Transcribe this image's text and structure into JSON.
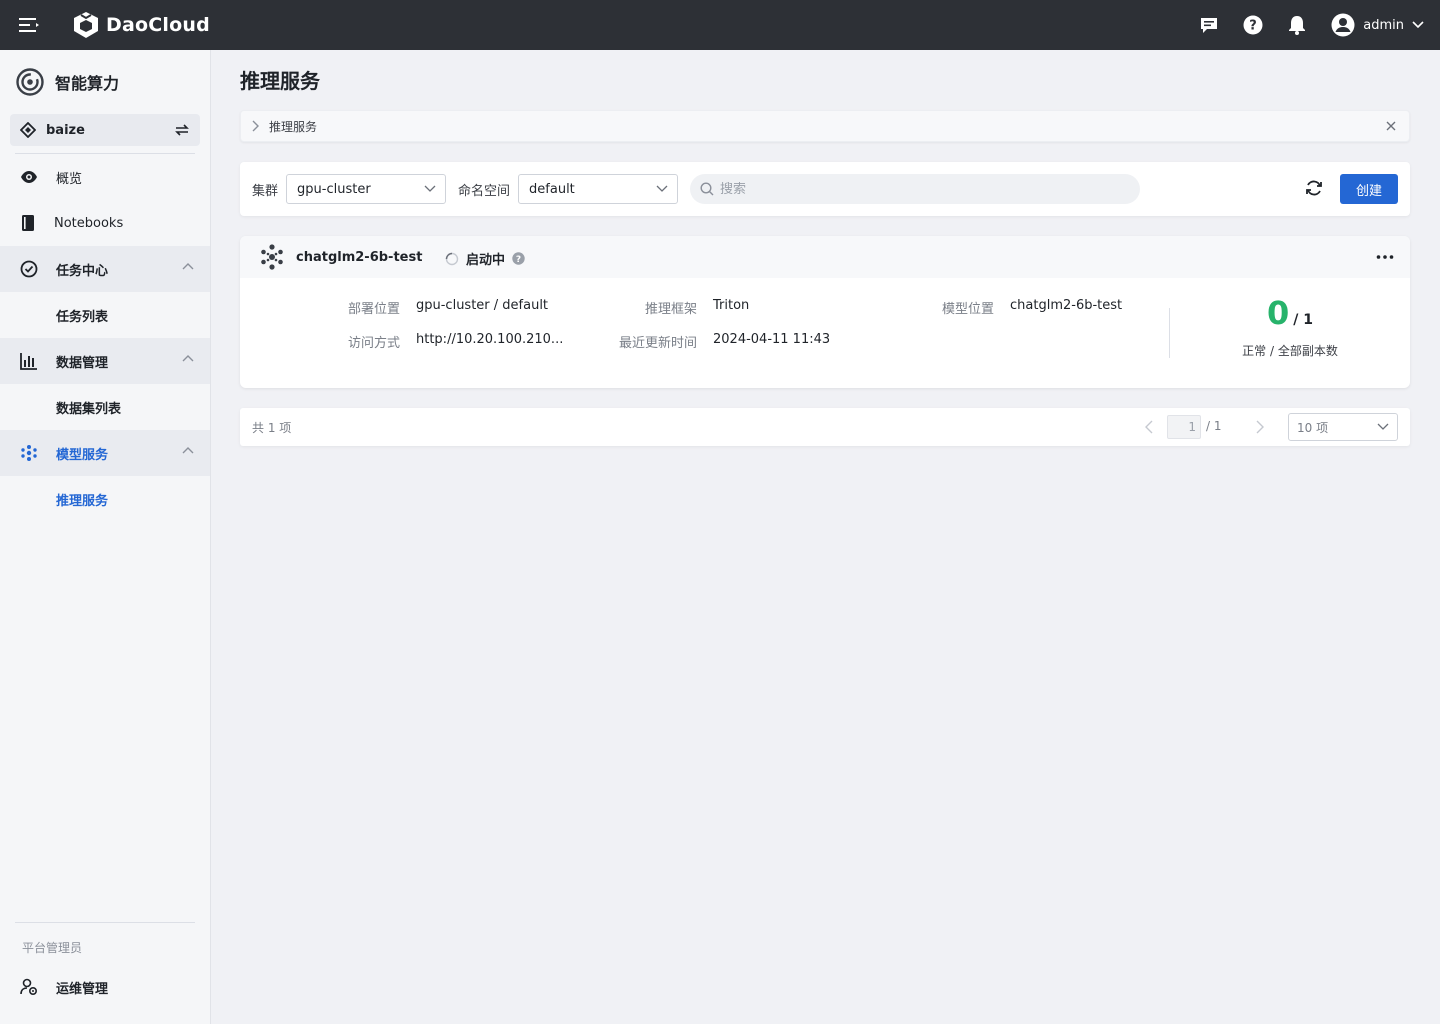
{
  "topbar": {
    "logo_text": "DaoCloud",
    "user_name": "admin",
    "icons": [
      "menu-icon",
      "message-icon",
      "help-icon",
      "bell-icon",
      "user-avatar-icon",
      "chevron-down-icon"
    ]
  },
  "sidebar": {
    "product_title": "智能算力",
    "workspace": "baize",
    "items": [
      {
        "label": "概览",
        "icon": "eye-icon"
      },
      {
        "label": "Notebooks",
        "icon": "notebook-icon"
      },
      {
        "label": "任务中心",
        "icon": "task-icon"
      },
      {
        "label": "任务列表"
      },
      {
        "label": "数据管理",
        "icon": "chart-icon"
      },
      {
        "label": "数据集列表"
      },
      {
        "label": "模型服务",
        "icon": "model-icon"
      },
      {
        "label": "推理服务"
      }
    ],
    "footer_label": "平台管理员",
    "footer_item": "运维管理"
  },
  "page": {
    "title": "推理服务",
    "tip": "推理服务"
  },
  "toolbar": {
    "cluster_label": "集群",
    "cluster_value": "gpu-cluster",
    "namespace_label": "命名空间",
    "namespace_value": "default",
    "search_placeholder": "搜索",
    "create_label": "创建"
  },
  "service": {
    "name": "chatglm2-6b-test",
    "status": "启动中",
    "fields": {
      "deploy_location_label": "部署位置",
      "deploy_location": "gpu-cluster / default",
      "framework_label": "推理框架",
      "framework": "Triton",
      "model_location_label": "模型位置",
      "model_location": "chatglm2-6b-test",
      "access_label": "访问方式",
      "access": "http://10.20.100.210...",
      "updated_label": "最近更新时间",
      "updated": "2024-04-11 11:43"
    },
    "replicas_ready": "0",
    "replicas_total": "/ 1",
    "replicas_label": "正常 / 全部副本数"
  },
  "pager": {
    "total": "共 1 项",
    "current": "1",
    "of": "/ 1",
    "page_size": "10 项"
  },
  "colors": {
    "accent": "#2467d4",
    "success": "#27b36b",
    "topbar": "#2d3036"
  }
}
